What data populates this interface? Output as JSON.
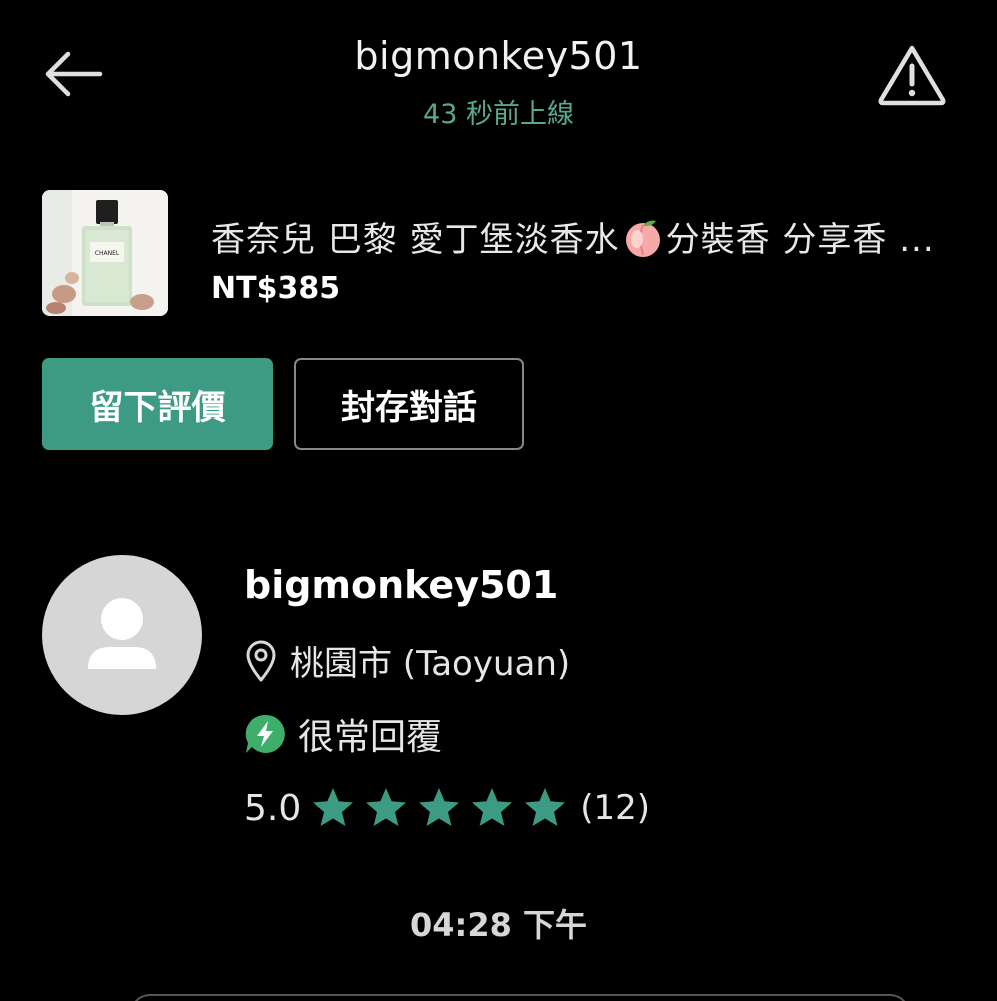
{
  "header": {
    "back_icon": "arrow-left-icon",
    "title": "bigmonkey501",
    "status": "43 秒前上線",
    "report_icon": "warning-triangle-icon",
    "status_color": "#5aa88f"
  },
  "listing": {
    "title_before": "香奈兒 巴黎 愛丁堡淡香水",
    "emoji_icon": "peach-emoji",
    "title_after": "分裝香 分享香 ...",
    "price": "NT$385",
    "thumbnail_label": "CHANEL"
  },
  "actions": {
    "review_label": "留下評價",
    "archive_label": "封存對話",
    "accent_color": "#3d9b83"
  },
  "profile": {
    "avatar_icon": "user-silhouette-icon",
    "name": "bigmonkey501",
    "location_icon": "map-pin-icon",
    "location": "桃園市 (Taoyuan)",
    "response_icon": "lightning-chat-icon",
    "response": "很常回覆",
    "rating_score": "5.0",
    "rating_stars": 5,
    "rating_count": "(12)",
    "star_color": "#3d9b83"
  },
  "chat": {
    "timestamp": "04:28 下午"
  }
}
